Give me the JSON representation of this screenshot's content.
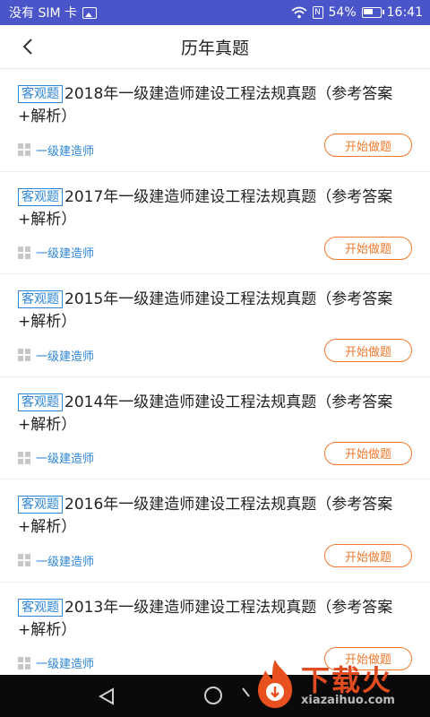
{
  "status_bar": {
    "carrier": "没有 SIM 卡",
    "battery": "54%",
    "time": "16:41"
  },
  "header": {
    "title": "历年真题"
  },
  "items": [
    {
      "tag": "客观题",
      "title": "2018年一级建造师建设工程法规真题（参考答案+解析）",
      "category": "一级建造师",
      "action": "开始做题"
    },
    {
      "tag": "客观题",
      "title": "2017年一级建造师建设工程法规真题（参考答案+解析）",
      "category": "一级建造师",
      "action": "开始做题"
    },
    {
      "tag": "客观题",
      "title": "2015年一级建造师建设工程法规真题（参考答案+解析）",
      "category": "一级建造师",
      "action": "开始做题"
    },
    {
      "tag": "客观题",
      "title": "2014年一级建造师建设工程法规真题（参考答案+解析）",
      "category": "一级建造师",
      "action": "开始做题"
    },
    {
      "tag": "客观题",
      "title": "2016年一级建造师建设工程法规真题（参考答案+解析）",
      "category": "一级建造师",
      "action": "开始做题"
    },
    {
      "tag": "客观题",
      "title": "2013年一级建造师建设工程法规真题（参考答案+解析）",
      "category": "一级建造师",
      "action": "开始做题"
    }
  ],
  "watermark": {
    "name": "下载火",
    "url": "xiazaihuo.com"
  },
  "colors": {
    "status_bar": "#4a55c9",
    "accent_blue": "#2e86d6",
    "accent_orange": "#ef7a2f"
  }
}
